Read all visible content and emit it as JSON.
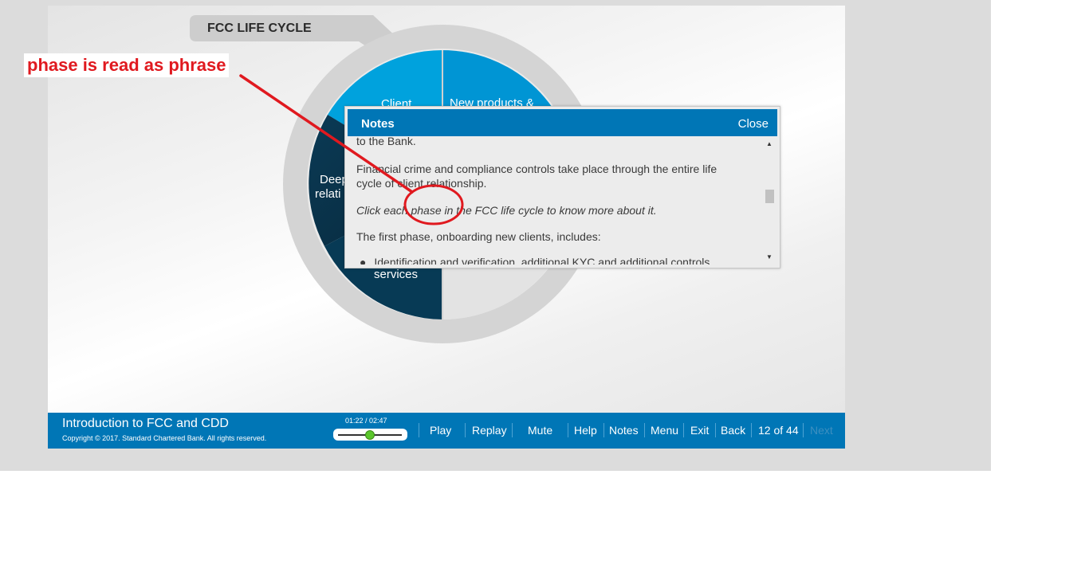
{
  "slide": {
    "lifecycle_title": "FCC LIFE CYCLE",
    "wheel_labels": {
      "client": "Client",
      "new_products": "New products &",
      "deepen": "Deep",
      "relationship": "relati",
      "services": "services"
    }
  },
  "notes": {
    "title": "Notes",
    "close_label": "Close",
    "lines": {
      "line1": "to the Bank.",
      "line2a": "Financial crime and compliance controls take place through the entire life",
      "line2b": "cycle of client relationship.",
      "line3": "Click each phase in the FCC life cycle to know more about it.",
      "line4": "The first phase, onboarding new clients, includes:",
      "line5": "Identification and verification, additional KYC and additional controls"
    }
  },
  "footer": {
    "course_title": "Introduction to FCC and CDD",
    "copyright": "Copyright © 2017. Standard Chartered Bank. All rights reserved.",
    "time": "01:22 / 02:47",
    "progress_fraction": 0.49,
    "buttons": {
      "play": "Play",
      "replay": "Replay",
      "mute": "Mute",
      "help": "Help",
      "notes": "Notes",
      "menu": "Menu",
      "exit": "Exit",
      "back": "Back",
      "page": "12 of 44",
      "next": "Next"
    }
  },
  "annotation": {
    "text": "phase is read as phrase"
  },
  "colors": {
    "brand_blue": "#0076b6",
    "annotation_red": "#e0191f"
  }
}
